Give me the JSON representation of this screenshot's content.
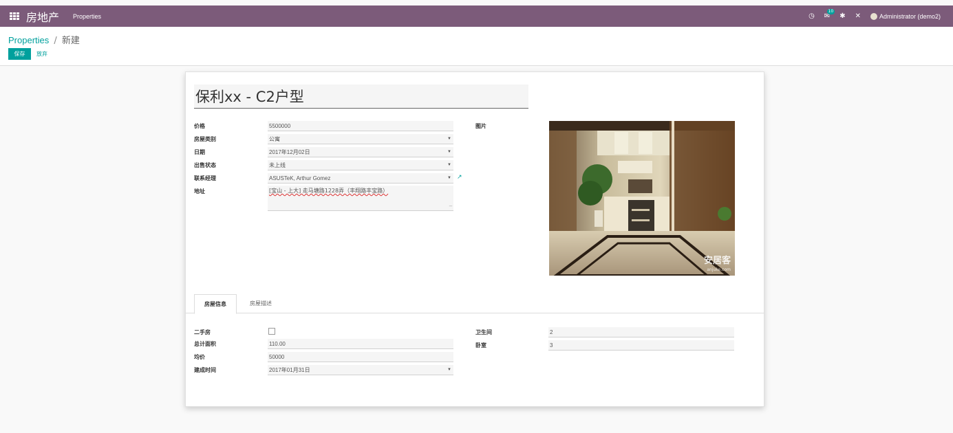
{
  "navbar": {
    "brand": "房地产",
    "menu_item": "Properties",
    "notification_count": "10",
    "user_label": "Administrator (demo2)"
  },
  "control_panel": {
    "breadcrumb_parent": "Properties",
    "breadcrumb_separator": "/",
    "breadcrumb_current": "新建",
    "save_label": "保存",
    "discard_label": "放弃"
  },
  "form": {
    "title": "保利xx - C2户型",
    "price_label": "价格",
    "price_value": "5500000",
    "type_label": "房屋类别",
    "type_value": "公寓",
    "date_label": "日期",
    "date_value": "2017年12月02日",
    "status_label": "出售状态",
    "status_value": "未上线",
    "manager_label": "联系经理",
    "manager_value": "ASUSTeK, Arthur Gomez",
    "address_label": "地址",
    "address_value": "[宝山 - 上大] 走马塘路1228弄（丰翔路丰宝路）",
    "image_label": "图片",
    "image_watermark": "安居客",
    "image_watermark_sub": "anjuke.com"
  },
  "tabs": [
    {
      "label": "房屋信息",
      "active": true
    },
    {
      "label": "房屋描述",
      "active": false
    }
  ],
  "house_info": {
    "second_hand_label": "二手房",
    "second_hand_checked": false,
    "area_label": "总计面积",
    "area_value": "110.00",
    "unit_price_label": "均价",
    "unit_price_value": "50000",
    "built_label": "建成时间",
    "built_value": "2017年01月31日",
    "bathroom_label": "卫生间",
    "bathroom_value": "2",
    "bedroom_label": "卧室",
    "bedroom_value": "3"
  },
  "colors": {
    "navbar": "#7c5b7a",
    "accent": "#00a09d"
  }
}
